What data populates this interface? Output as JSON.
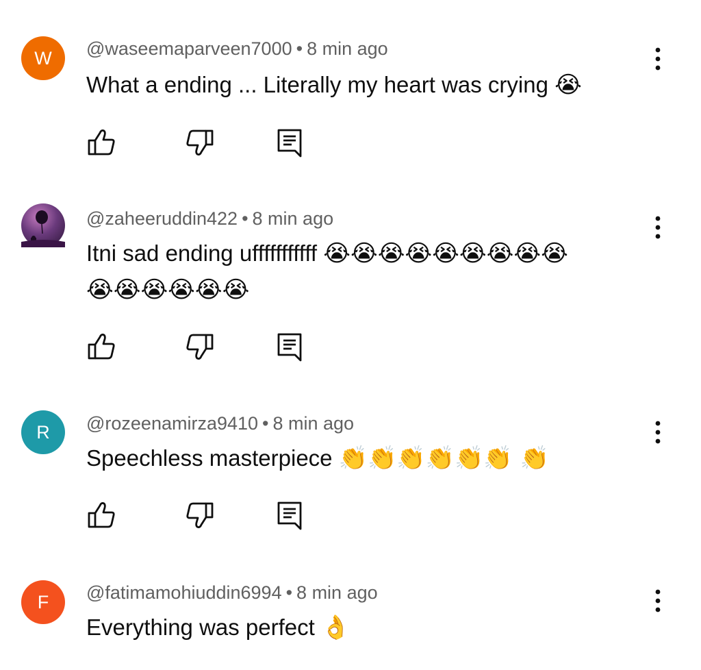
{
  "comments": [
    {
      "avatar_letter": "W",
      "avatar_color": "#ef6c00",
      "handle": "@waseemaparveen7000",
      "separator": "•",
      "time": "8 min ago",
      "text": "What a ending ... Literally my heart was crying",
      "emoji_line1": "😭",
      "emoji_line2": ""
    },
    {
      "avatar_letter": "",
      "avatar_color": "#3a1c4a",
      "handle": "@zaheeruddin422",
      "separator": "•",
      "time": "8 min ago",
      "text": "Itni sad ending ufffffffffff",
      "emoji_line1": "😭😭😭😭😭😭😭😭😭",
      "emoji_line2": "😭😭😭😭😭😭"
    },
    {
      "avatar_letter": "R",
      "avatar_color": "#1e9aa8",
      "handle": "@rozeenamirza9410",
      "separator": "•",
      "time": "8 min ago",
      "text": "Speechless masterpiece",
      "emoji_line1": "👏👏👏👏👏👏 👏",
      "emoji_line2": ""
    },
    {
      "avatar_letter": "F",
      "avatar_color": "#f4511e",
      "handle": "@fatimamohiuddin6994",
      "separator": "•",
      "time": "8 min ago",
      "text": "Everything was perfect",
      "emoji_line1": "👌",
      "emoji_line2": ""
    }
  ],
  "icons": {
    "like": "thumbs-up-icon",
    "dislike": "thumbs-down-icon",
    "reply": "reply-icon",
    "more": "more-vert-icon"
  }
}
